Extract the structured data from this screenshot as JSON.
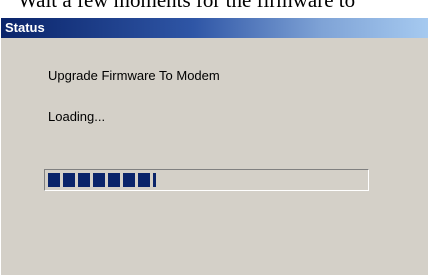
{
  "background": {
    "text": "Wait a few moments for the firmware to"
  },
  "dialog": {
    "title": "Status",
    "message": "Upgrade Firmware To Modem",
    "status": "Loading..."
  },
  "progress": {
    "value_percent": 34,
    "color": "#0a246a"
  },
  "colors": {
    "titlebar_start": "#0a246a",
    "titlebar_end": "#a6caf0",
    "dialog_bg": "#d4d0c8"
  }
}
